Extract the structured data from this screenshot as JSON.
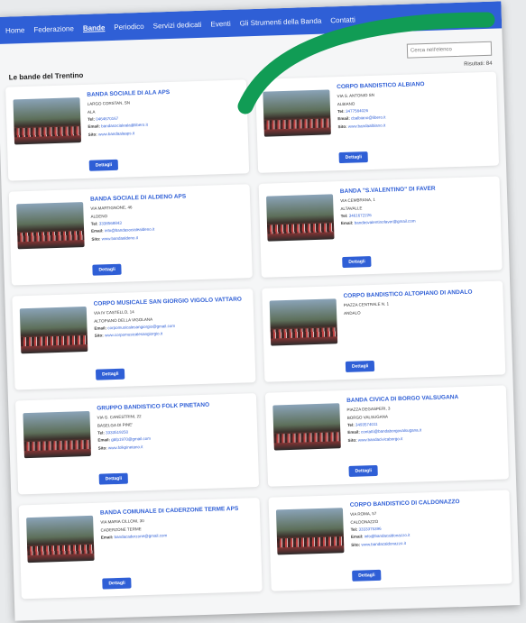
{
  "nav": {
    "items": [
      "Home",
      "Federazione",
      "Bande",
      "Periodico",
      "Servizi dedicati",
      "Eventi",
      "Gli Strumenti della Banda",
      "Contatti"
    ],
    "active_index": 2
  },
  "page": {
    "title": "Le bande del Trentino",
    "count": "Risultati: 84"
  },
  "search": {
    "placeholder": "Cerca nell'elenco"
  },
  "labels": {
    "tel": "Tel:",
    "email": "Email:",
    "sito": "Sito:",
    "details": "Dettagli"
  },
  "bands": [
    {
      "name": "BANDA SOCIALE DI ALA APS",
      "address": "LARGO CORSTAN, SN",
      "town": "ALA",
      "tel": "0464670167",
      "email": "bandasocialeala@libero.it",
      "site": "www.bandaalaaps.it"
    },
    {
      "name": "CORPO BANDISTICO ALBIANO",
      "address": "VIA S. ANTONIO SN",
      "town": "ALBIANO",
      "tel": "3477584026",
      "email": "cbalbiano@libero.it",
      "site": "www.bandaalbiano.it"
    },
    {
      "name": "BANDA SOCIALE DI ALDENO APS",
      "address": "VIA MARTIGNONE, 46",
      "town": "ALDENO",
      "tel": "3338568843",
      "email": "info@bandasocialealdeno.it",
      "site": "www.bandaaldeno.it"
    },
    {
      "name": "BANDA \"S.VALENTINO\" DI FAVER",
      "address": "VIA CEMBRANA, 1",
      "town": "ALTAVALLE",
      "tel": "3461672226",
      "email": "bandasvalentinofaver@gmail.com",
      "site": ""
    },
    {
      "name": "CORPO MUSICALE SAN GIORGIO VIGOLO VATTARO",
      "address": "VIA IV CASTELLO, 14",
      "town": "ALTOPIANO DELLA VIGOLANA",
      "tel": "",
      "email": "corpomusicalesangiorgio@gmail.com",
      "site": "www.corpomusicalesangiorgio.it"
    },
    {
      "name": "CORPO BANDISTICO ALTOPIANO DI ANDALO",
      "address": "PIAZZA CENTRALE N. 1",
      "town": "ANDALO",
      "tel": "",
      "email": "",
      "site": ""
    },
    {
      "name": "GRUPPO BANDISTICO FOLK PINETANO",
      "address": "VIA G. CANESTRINI, 22",
      "town": "BASELGA DI PINE'",
      "tel": "3333519250",
      "email": "gbfp1970@gmail.com",
      "site": "www.folkpinetano.it"
    },
    {
      "name": "BANDA CIVICA DI BORGO VALSUGANA",
      "address": "PIAZZA DEGASPERI, 3",
      "town": "BORGO VALSUGANA",
      "tel": "3493574011",
      "email": "contatti@bandaborgovalsugana.it",
      "site": "www.bandacivicaborgo.it"
    },
    {
      "name": "BANDA COMUNALE DI CADERZONE TERME APS",
      "address": "VIA MARIA CILLONI, 30",
      "town": "CADERZONE TERME",
      "tel": "",
      "email": "bandacaderzone@gmail.com",
      "site": ""
    },
    {
      "name": "CORPO BANDISTICO DI CALDONAZZO",
      "address": "VIA ROMA, 57",
      "town": "CALDONAZZO",
      "tel": "3333375396",
      "email": "info@bandacaldonazzo.it",
      "site": "www.bandacaldonazzo.it"
    }
  ],
  "colors": {
    "primary": "#2f5fd6",
    "swoosh": "#119c55"
  }
}
